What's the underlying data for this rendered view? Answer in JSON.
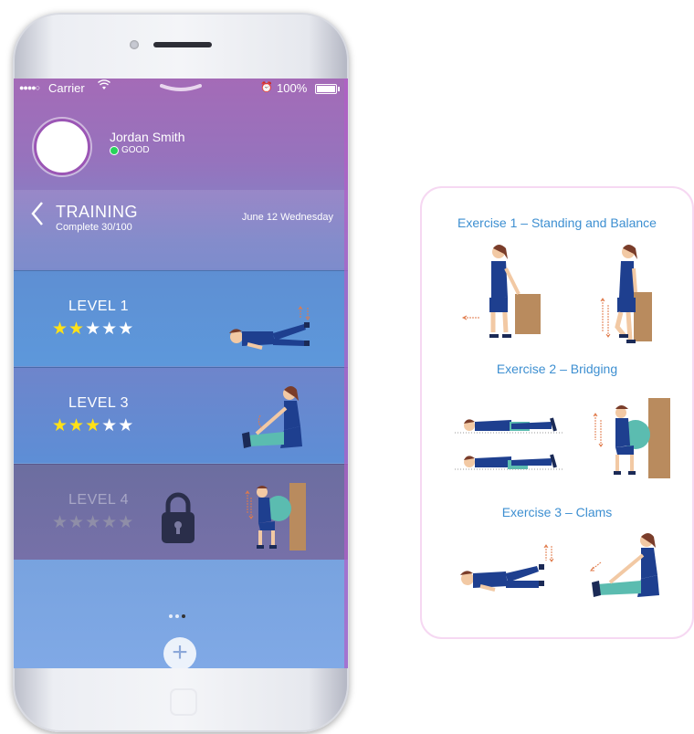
{
  "status_bar": {
    "signal": "●●●●○",
    "carrier": "Carrier",
    "battery": "100%"
  },
  "profile": {
    "name": "Jordan Smith",
    "status": "GOOD"
  },
  "training": {
    "back_icon": "chevron-left-icon",
    "title": "TRAINING",
    "progress": "Complete 30/100",
    "date": "June 12 Wednesday"
  },
  "levels": [
    {
      "label": "LEVEL 1",
      "stars_total": 5,
      "stars_filled": 2,
      "locked": false
    },
    {
      "label": "LEVEL 3",
      "stars_total": 5,
      "stars_filled": 3,
      "locked": false
    },
    {
      "label": "LEVEL 4",
      "stars_total": 5,
      "stars_filled": 0,
      "locked": true
    }
  ],
  "pager": {
    "pages": 3,
    "active": 3
  },
  "add_button": "+",
  "exercises": [
    {
      "title": "Exercise 1 – Standing and Balance"
    },
    {
      "title": "Exercise 2 – Bridging"
    },
    {
      "title": "Exercise 3 – Clams"
    }
  ],
  "colors": {
    "accent_blue": "#3d8fd1",
    "star_gold": "#ffe117",
    "card_border": "#f6d8f2",
    "figure_navy": "#1e3f8f",
    "ball_teal": "#5bbcb0",
    "box_brown": "#b98b5e"
  }
}
